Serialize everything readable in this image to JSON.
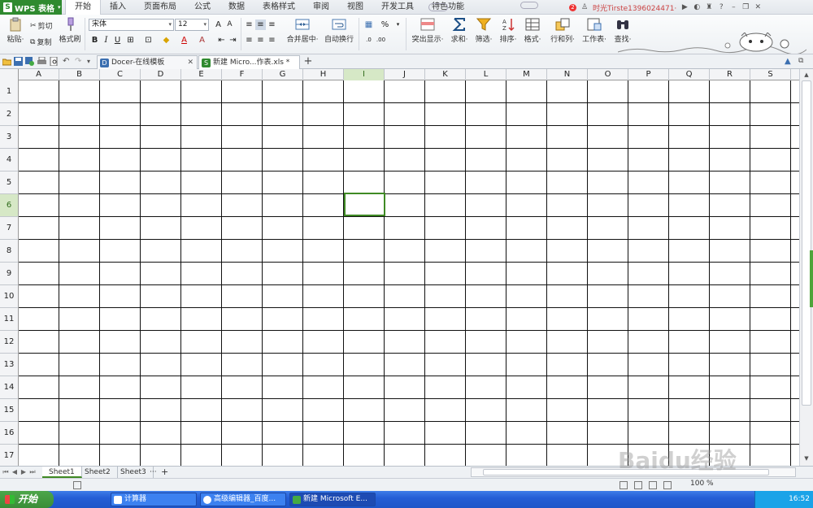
{
  "app": {
    "name": "WPS 表格",
    "menu_tabs": [
      "开始",
      "插入",
      "页面布局",
      "公式",
      "数据",
      "表格样式",
      "审阅",
      "视图",
      "开发工具",
      "特色功能"
    ],
    "active_tab": "开始",
    "notification_count": "2",
    "user_name": "时光Tirste1396024471·"
  },
  "ribbon": {
    "paste_label": "粘贴·",
    "cut_label": "剪切",
    "copy_label": "复制",
    "format_painter_label": "格式刷",
    "font_name": "宋体",
    "font_size": "12",
    "bold": "B",
    "italic": "I",
    "underline": "U",
    "merge_center_label": "合并居中·",
    "auto_wrap_label": "自动换行",
    "percent_label": "%",
    "highlight_label": "突出显示·",
    "sum_label": "求和·",
    "filter_label": "筛选·",
    "sort_label": "排序·",
    "format_label": "格式·",
    "row_col_label": "行和列·",
    "sheet_label": "工作表·",
    "find_label": "查找·"
  },
  "doc_tabs": [
    {
      "label": "Docer-在线模板",
      "active": false
    },
    {
      "label": "新建 Micro...作表.xls *",
      "active": true
    }
  ],
  "grid": {
    "columns": [
      "A",
      "B",
      "C",
      "D",
      "E",
      "F",
      "G",
      "H",
      "I",
      "J",
      "K",
      "L",
      "M",
      "N",
      "O",
      "P",
      "Q",
      "R",
      "S"
    ],
    "rows": [
      "1",
      "2",
      "3",
      "4",
      "5",
      "6",
      "7",
      "8",
      "9",
      "10",
      "11",
      "12",
      "13",
      "14",
      "15",
      "16",
      "17"
    ],
    "selected_column": "I",
    "selected_row": "6"
  },
  "sheets": [
    "Sheet1",
    "Sheet2",
    "Sheet3"
  ],
  "active_sheet": "Sheet1",
  "sheet_more": "···",
  "status": {
    "zoom": "100 %"
  },
  "taskbar": {
    "start_label": "开始",
    "windows": [
      {
        "label": "计算器",
        "active": false
      },
      {
        "label": "高级编辑器_百度...",
        "active": false
      },
      {
        "label": "新建 Microsoft E...",
        "active": true
      }
    ],
    "clock": "16:52"
  },
  "watermark": "Baidu经验",
  "colors": {
    "accent_green": "#3f8a24",
    "app_button": "#2f8a2f",
    "taskbar_blue": "#245ed6",
    "selection_header": "#d6e8c6"
  }
}
